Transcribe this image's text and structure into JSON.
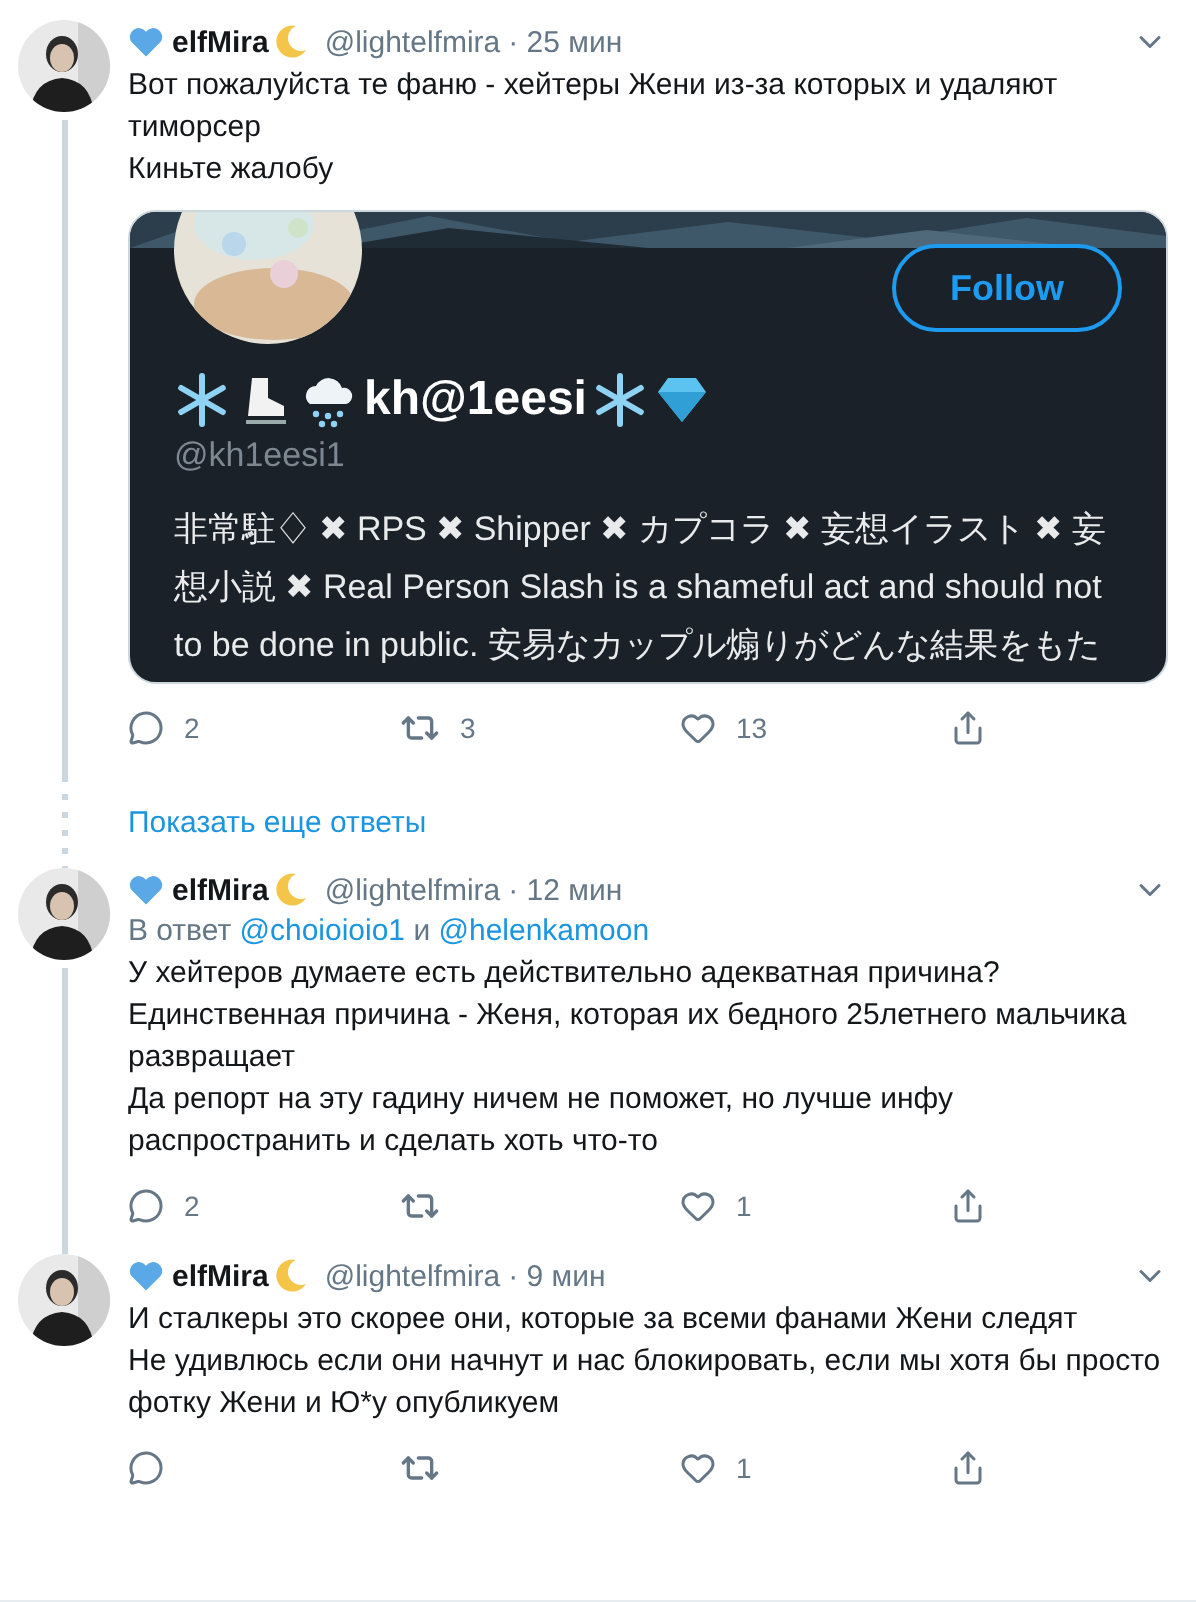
{
  "tweets": [
    {
      "name": "elfMira",
      "handle": "@lightelfmira",
      "time": "· 25 мин",
      "thread_continues": true,
      "paragraphs": [
        "Вот пожалуйста те фаню - хейтеры Жени из-за которых и удаляют тиморсер",
        "Киньте жалобу"
      ],
      "embed": {
        "kind": "profile",
        "display_name": "kh@1eesi",
        "handle": "@kh1eesi1",
        "follow": "Follow",
        "bio": "非常駐♢ ✖ RPS ✖ Shipper ✖ カプコラ ✖ 妄想イラスト ✖ 妄想小説 ✖  Real Person Slash is a shameful act and should not to be done in public. 安易なカップル煽りがどんな結果をもた"
      },
      "actions": {
        "replies": "2",
        "retweets": "3",
        "likes": "13"
      },
      "show_more": "Показать еще ответы"
    },
    {
      "name": "elfMira",
      "handle": "@lightelfmira",
      "time": "· 12 мин",
      "thread_continues": true,
      "reply_to": {
        "prefix": "В ответ",
        "joiner": "и",
        "users": [
          "@choioioio1",
          "@helenkamoon"
        ]
      },
      "paragraphs": [
        "У хейтеров думаете есть действительно адекватная причина?",
        "Единственная причина - Женя, которая их бедного 25летнего мальчика развращает",
        "Да репорт на эту гадину ничем не поможет, но лучше инфу распространить и сделать хоть что-то"
      ],
      "actions": {
        "replies": "2",
        "likes": "1"
      }
    },
    {
      "name": "elfMira",
      "handle": "@lightelfmira",
      "time": "· 9 мин",
      "thread_continues": false,
      "paragraphs": [
        "И сталкеры это скорее они, которые за всеми фанами Жени следят",
        "Не удивлюсь если они начнут и нас блокировать, если мы хотя бы просто фотку Жени и Ю*у опубликуем"
      ],
      "actions": {
        "likes": "1"
      }
    }
  ]
}
